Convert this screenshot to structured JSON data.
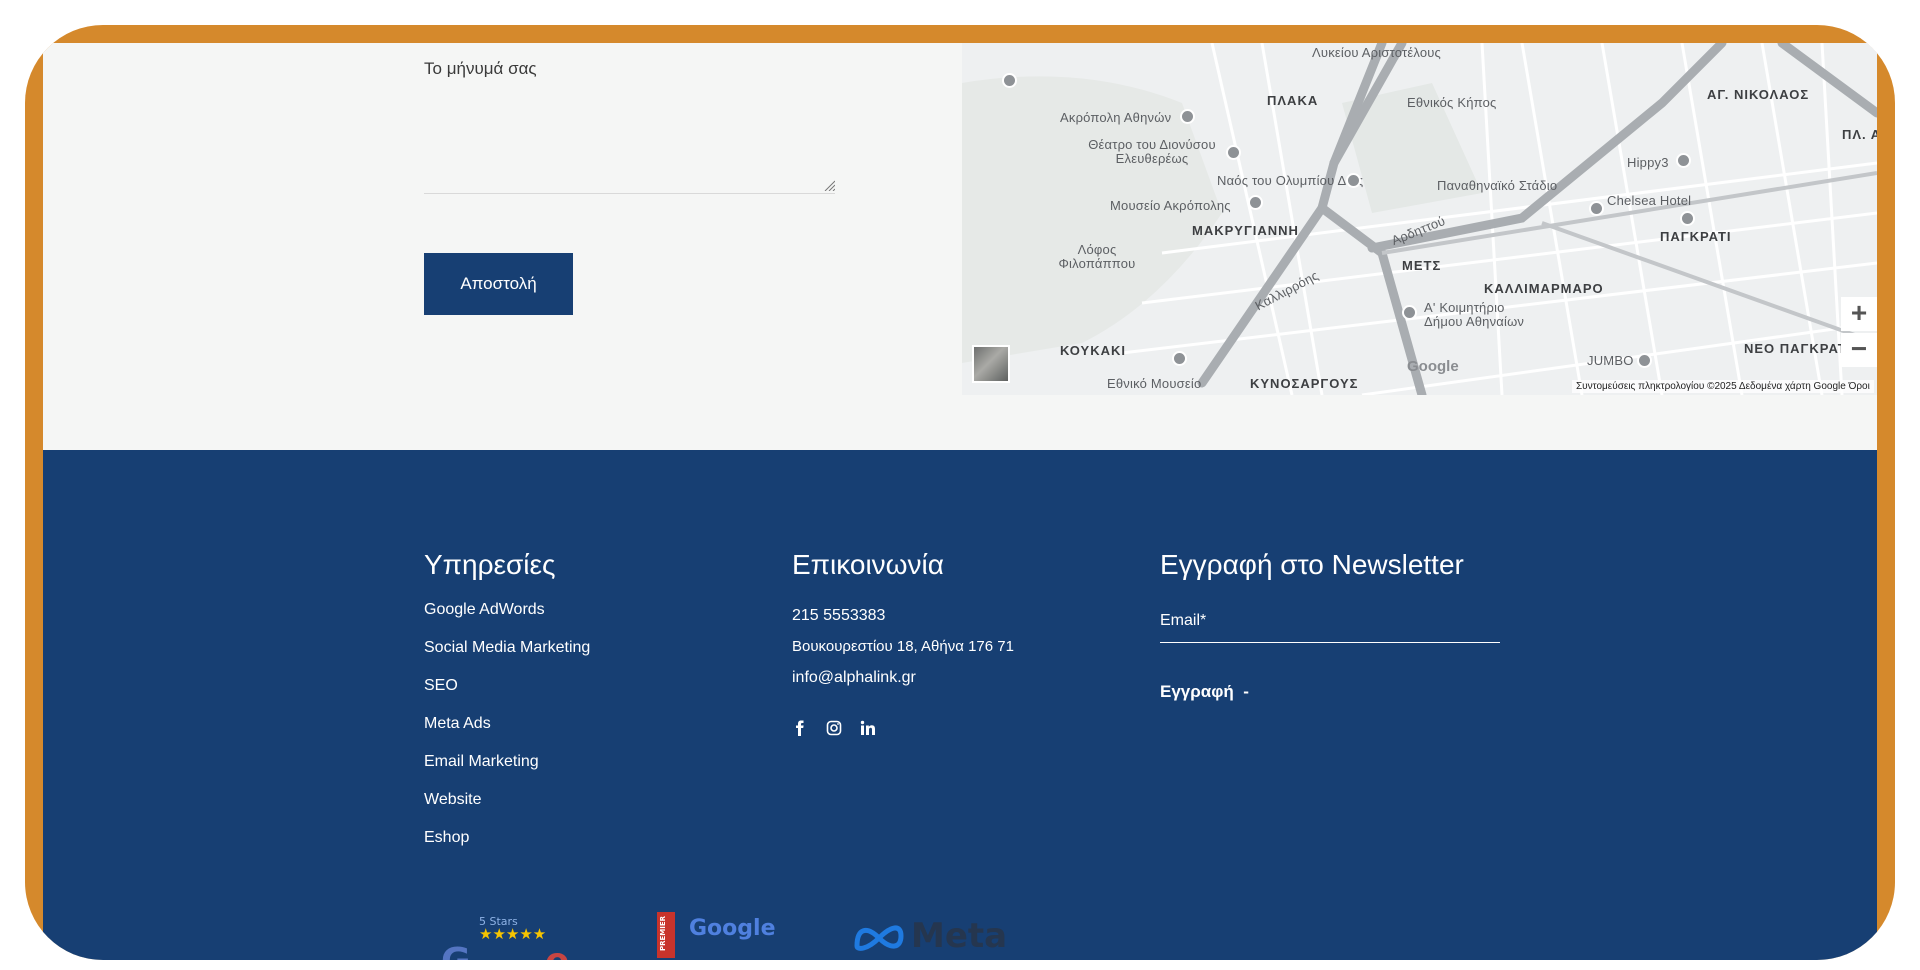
{
  "contact_form": {
    "message_label": "Το μήνυμά σας",
    "message_value": "",
    "send_label": "Αποστολή"
  },
  "map": {
    "labels": [
      "Λυκείου Αριστοτέλους",
      "ΠΛΑΚΑ",
      "Εθνικός Κήπος",
      "ΑΓ. ΝΙΚΟΛΑΟΣ",
      "Ακρόπολη Αθηνών",
      "Θέατρο του Διονύσου Ελευθερέως",
      "Ναός του Ολυμπίου Διός",
      "Μουσείο Ακρόπολης",
      "ΜΑΚΡΥΓΙΑΝΝΗ",
      "Παναθηναϊκό Στάδιο",
      "Chelsea Hotel",
      "ΠΑΓΚΡΑΤΙ",
      "Λόφος Φιλοπάππου",
      "ΜΕΤΣ",
      "ΚΑΛΛΙΜΑΡΜΑΡΟ",
      "Α' Κοιμητήριο Δήμου Αθηναίων",
      "ΚΟΥΚΑΚΙ",
      "Εθνικό Μουσείο",
      "ΚΥΝΟΣΑΡΓΟΥΣ",
      "JUMBO",
      "ΝΕΟ ΠΑΓΚΡΑΤ",
      "Καλλιρρόης",
      "Αρδηττού",
      "Hippy3",
      "ΠΛ. Α"
    ],
    "google": "Google",
    "credit": "Συντομεύσεις πληκτρολογίου   ©2025 Δεδομένα χάρτη Google   Όροι",
    "zoom_in": "+",
    "zoom_out": "−"
  },
  "footer": {
    "services": {
      "title": "Υπηρεσίες",
      "items": [
        "Google AdWords",
        "Social Media Marketing",
        "SEO",
        "Meta Ads",
        "Email Marketing",
        "Website",
        "Eshop"
      ]
    },
    "contact": {
      "title": "Επικοινωνία",
      "phone": "215 5553383",
      "address": "Βουκουρεστίου 18, Αθήνα 176 71",
      "email": "info@alphalink.gr",
      "social_icons": [
        "facebook-icon",
        "instagram-icon",
        "linkedin-icon"
      ]
    },
    "newsletter": {
      "title": "Εγγραφή στο Newsletter",
      "email_label": "Email*",
      "submit_label": "Εγγραφή  -"
    },
    "badges": {
      "stars": "5 Stars",
      "google_partner": "Google",
      "partner_tag": "PREMIER",
      "meta": "Meta"
    }
  },
  "colors": {
    "frame": "#d5892c",
    "footer_bg": "#173f73",
    "button_bg": "#173f73",
    "page_bg": "#f5f6f5"
  }
}
